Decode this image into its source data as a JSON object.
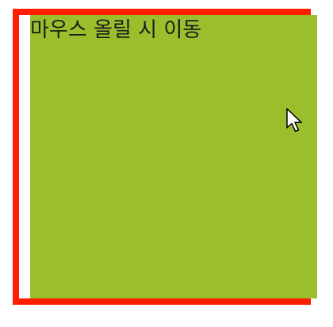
{
  "hover_box": {
    "label": "마우스 올릴 시 이동",
    "color": "#9bbf2c"
  },
  "frame": {
    "border_color": "#ff1f00"
  },
  "cursor": {
    "icon": "arrow-pointer-icon"
  }
}
